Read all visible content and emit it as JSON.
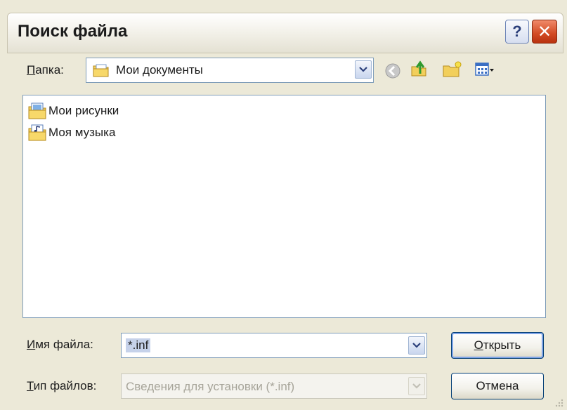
{
  "window": {
    "title": "Поиск файла",
    "help_glyph": "?",
    "close_glyph": "✕"
  },
  "folder": {
    "label_accel": "П",
    "label_rest": "апка:",
    "current": "Мои документы",
    "toolbar_icons": [
      "back-icon",
      "up-folder-icon",
      "new-folder-icon",
      "view-menu-icon"
    ]
  },
  "files": [
    {
      "name": "Мои рисунки",
      "icon": "pictures-folder-icon"
    },
    {
      "name": "Моя музыка",
      "icon": "music-folder-icon"
    }
  ],
  "filename": {
    "label_accel": "И",
    "label_rest": "мя файла:",
    "value": "*.inf"
  },
  "filetype": {
    "label_accel": "Т",
    "label_rest": "ип файлов:",
    "value": "Сведения для установки (*.inf)"
  },
  "buttons": {
    "open_accel": "О",
    "open_rest": "ткрыть",
    "cancel": "Отмена"
  },
  "colors": {
    "dialog_bg": "#ece9d8",
    "border": "#7f9db9",
    "default_button_ring": "#7fa4e6",
    "close_button": "#d24a22"
  }
}
